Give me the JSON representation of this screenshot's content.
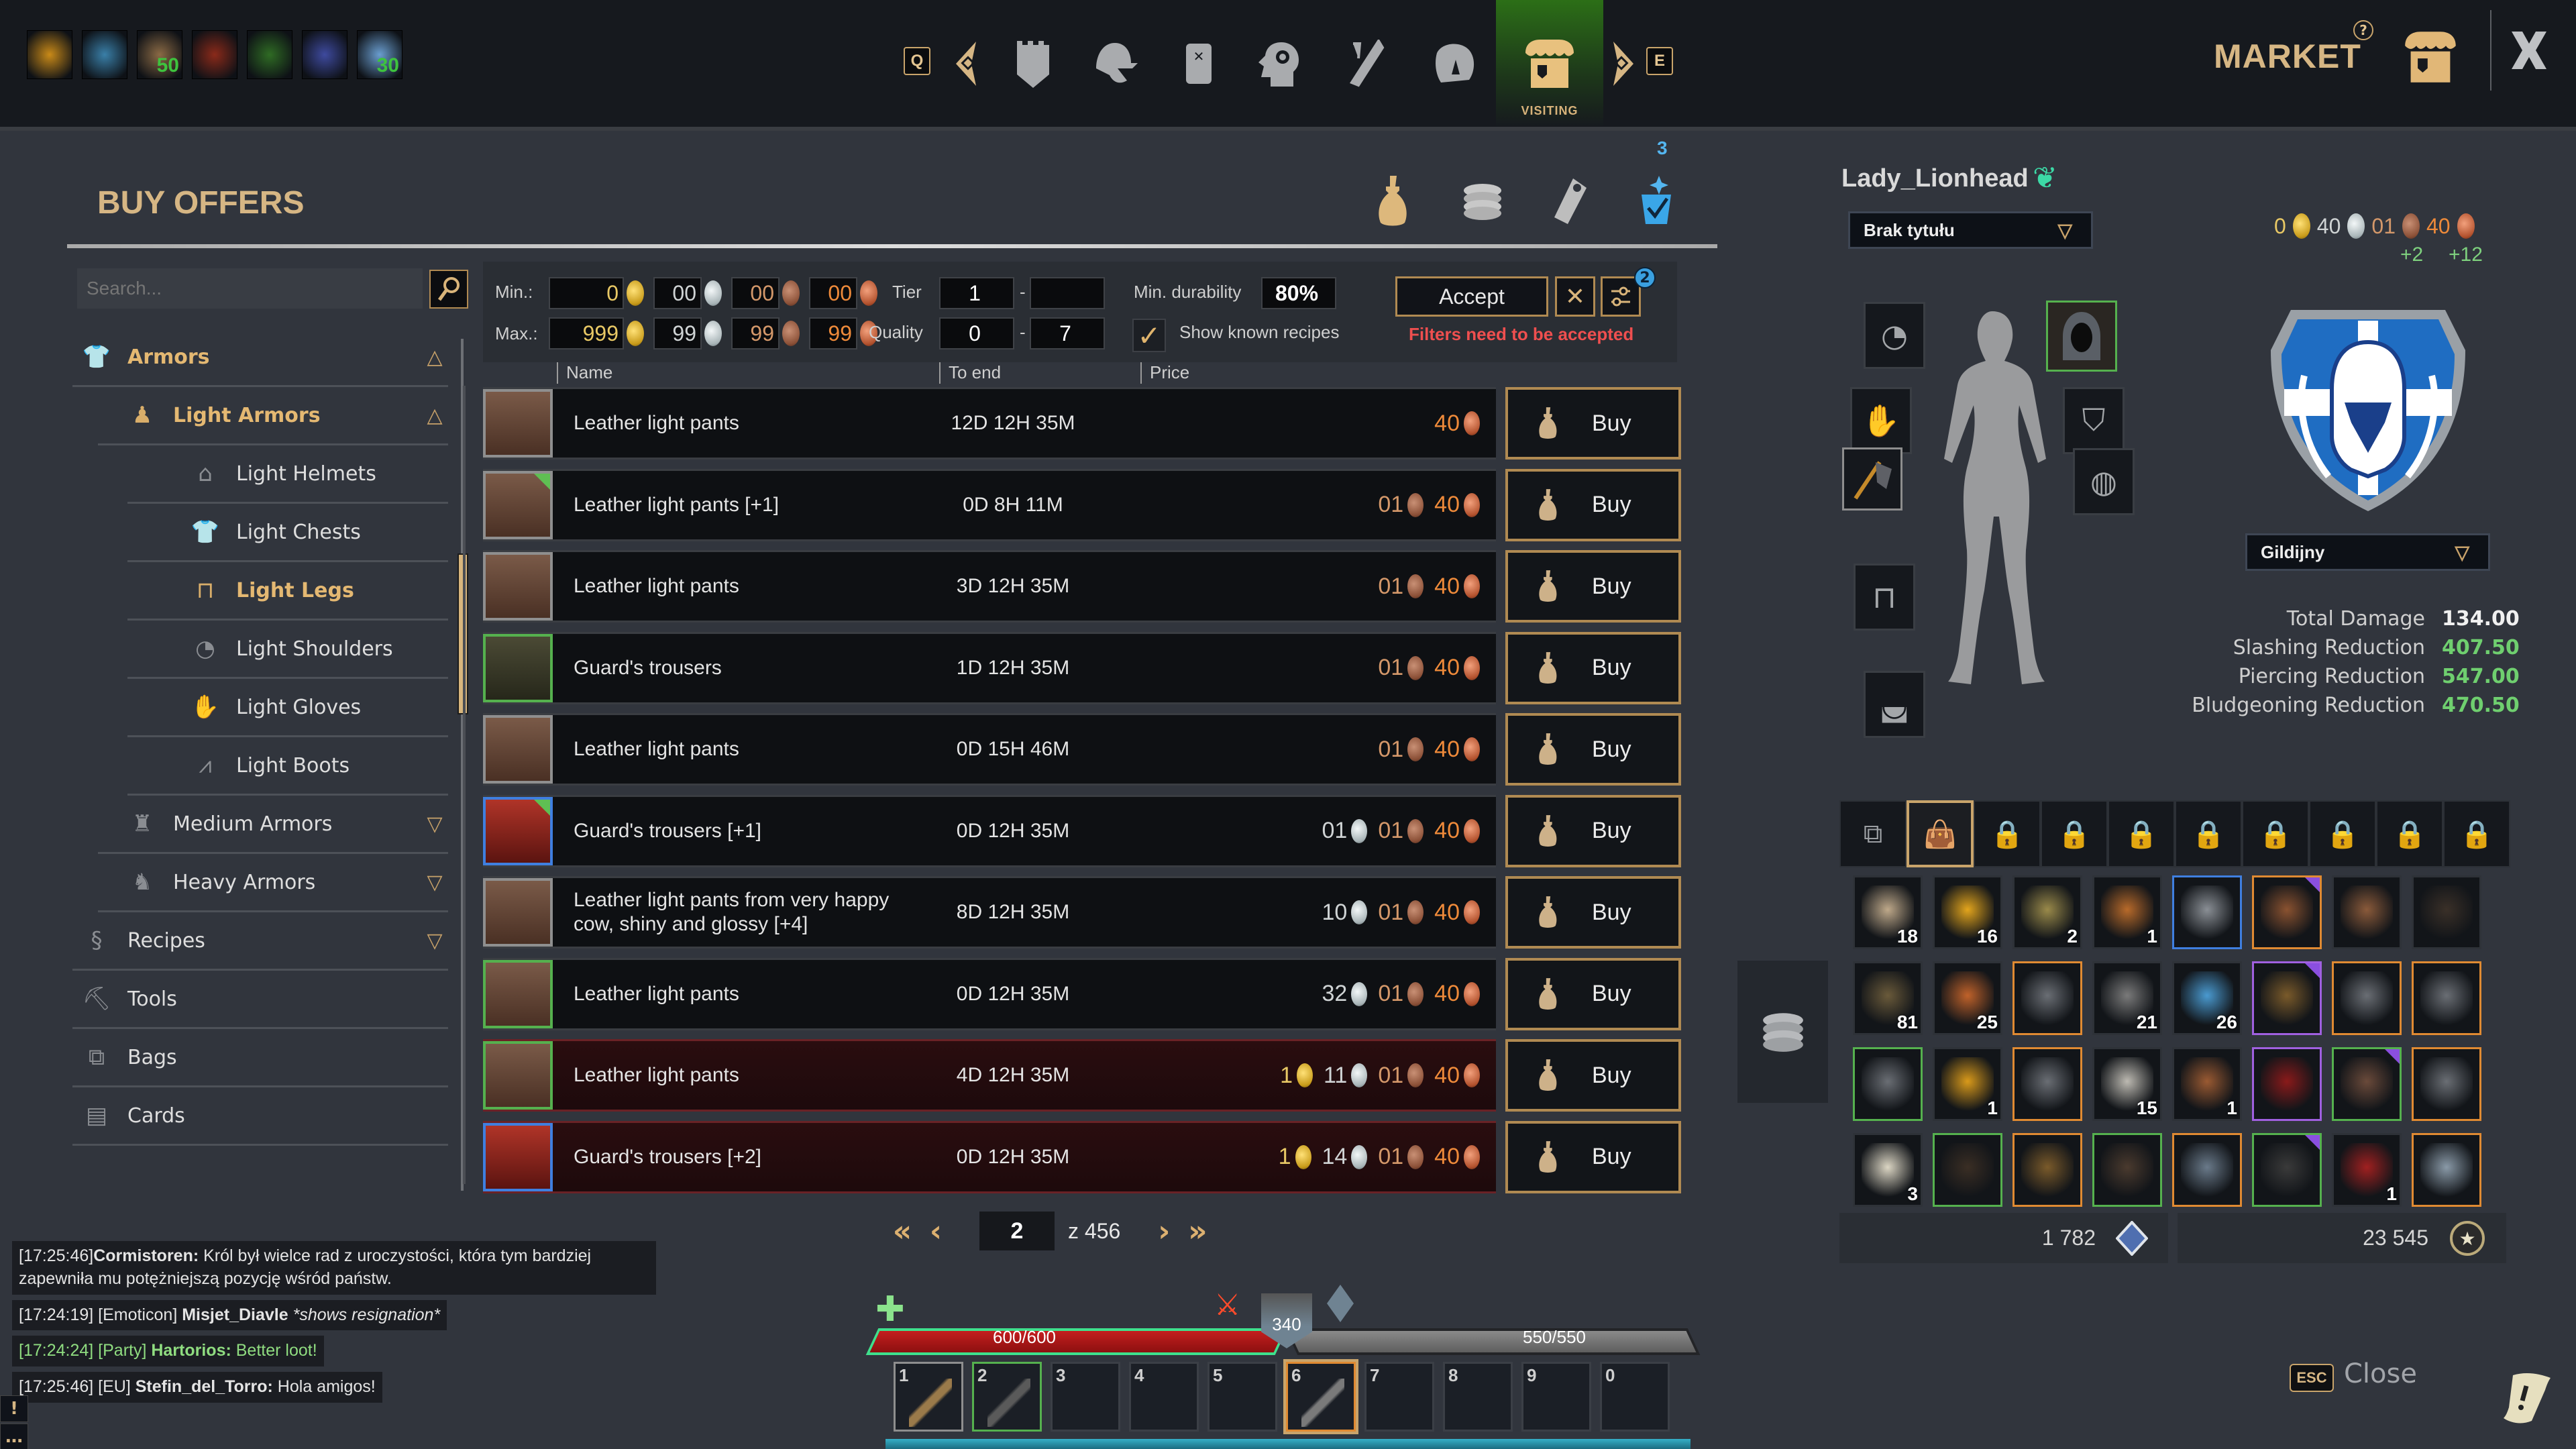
{
  "topbar": {
    "buffs": [
      {
        "name": "gold-lily-buff-icon",
        "badge": "",
        "color": "#c98a18"
      },
      {
        "name": "ice-warrior-buff-icon",
        "badge": "",
        "color": "#3a7fa8"
      },
      {
        "name": "hammer-buff-icon",
        "badge": "50",
        "color": "#8b6a45"
      },
      {
        "name": "red-gauntlet-buff-icon",
        "badge": "",
        "color": "#8a2a1a"
      },
      {
        "name": "rank-chevrons-buff-icon",
        "badge": "",
        "color": "#2f6b24"
      },
      {
        "name": "dove-buff-icon",
        "badge": "",
        "color": "#3e4a9e"
      },
      {
        "name": "map-buff-icon",
        "badge": "30",
        "color": "#6a9ed0"
      }
    ],
    "nav_keys": {
      "prev": "Q",
      "next": "E"
    },
    "nav_icons": [
      "guild-banner-icon",
      "helmet-icon",
      "scroll-quest-icon",
      "skills-head-gear-icon",
      "crafting-hammer-icon",
      "world-map-icon",
      "market-stall-icon"
    ],
    "active_nav_label": "VISITING",
    "title": "MARKET",
    "help_glyph": "?"
  },
  "buy_offers": {
    "title": "BUY OFFERS",
    "tabs": [
      "money-bag-tab-icon",
      "coin-stack-tab-icon",
      "price-tag-tab-icon",
      "recipe-scroll-tab-icon"
    ],
    "recipe_tab_badge": "3",
    "search": {
      "placeholder": "Search...",
      "value": ""
    },
    "categories": [
      {
        "label": "Armors",
        "level": 0,
        "state": "expanded",
        "highlight": true,
        "icon": "armor-icon"
      },
      {
        "label": "Light Armors",
        "level": 1,
        "state": "expanded",
        "highlight": true,
        "icon": "light-armor-icon"
      },
      {
        "label": "Light Helmets",
        "level": 2,
        "state": "",
        "highlight": false,
        "icon": "hood-icon"
      },
      {
        "label": "Light Chests",
        "level": 2,
        "state": "",
        "highlight": false,
        "icon": "shirt-icon"
      },
      {
        "label": "Light Legs",
        "level": 2,
        "state": "",
        "highlight": true,
        "icon": "pants-icon"
      },
      {
        "label": "Light Shoulders",
        "level": 2,
        "state": "",
        "highlight": false,
        "icon": "shoulder-icon"
      },
      {
        "label": "Light Gloves",
        "level": 2,
        "state": "",
        "highlight": false,
        "icon": "gloves-icon"
      },
      {
        "label": "Light Boots",
        "level": 2,
        "state": "",
        "highlight": false,
        "icon": "boots-icon"
      },
      {
        "label": "Medium Armors",
        "level": 1,
        "state": "collapsed",
        "highlight": false,
        "icon": "medium-armor-icon"
      },
      {
        "label": "Heavy Armors",
        "level": 1,
        "state": "collapsed",
        "highlight": false,
        "icon": "heavy-armor-icon"
      },
      {
        "label": "Recipes",
        "level": 0,
        "state": "collapsed",
        "highlight": false,
        "icon": "recipe-icon"
      },
      {
        "label": "Tools",
        "level": 0,
        "state": "",
        "highlight": false,
        "icon": "pickaxe-icon"
      },
      {
        "label": "Bags",
        "level": 0,
        "state": "",
        "highlight": false,
        "icon": "bags-icon"
      },
      {
        "label": "Cards",
        "level": 0,
        "state": "",
        "highlight": false,
        "icon": "cards-icon"
      }
    ],
    "filters": {
      "min_label": "Min.:",
      "max_label": "Max.:",
      "min_price": {
        "gold": "0",
        "silver": "00",
        "copper": "00",
        "bronze": "00"
      },
      "max_price": {
        "gold": "999",
        "silver": "99",
        "copper": "99",
        "bronze": "99"
      },
      "tier_label": "Tier",
      "tier_min": "1",
      "tier_max": "",
      "quality_label": "Quality",
      "quality_min": "0",
      "quality_max": "7",
      "range_sep": "-",
      "durability_label": "Min. durability",
      "durability_value": "80%",
      "known_recipes_label": "Show known recipes",
      "known_recipes_checked": true,
      "accept_label": "Accept",
      "clear_glyph": "✕",
      "advanced_badge": "2",
      "warning": "Filters need to be accepted"
    },
    "columns": {
      "name": "Name",
      "to_end": "To end",
      "price": "Price"
    },
    "buy_label": "Buy",
    "offers": [
      {
        "name": "Leather light pants",
        "to_end": "12D 12H 35M",
        "gold": "",
        "silver": "",
        "copper": "",
        "bronze": "40",
        "thumb": "leather",
        "border": "grey",
        "corner": false,
        "red": false
      },
      {
        "name": "Leather light pants [+1]",
        "to_end": "0D 8H 11M",
        "gold": "",
        "silver": "",
        "copper": "01",
        "bronze": "40",
        "thumb": "leather",
        "border": "grey",
        "corner": true,
        "red": false
      },
      {
        "name": "Leather light pants",
        "to_end": "3D 12H 35M",
        "gold": "",
        "silver": "",
        "copper": "01",
        "bronze": "40",
        "thumb": "leather",
        "border": "grey",
        "corner": false,
        "red": false
      },
      {
        "name": "Guard's trousers",
        "to_end": "1D 12H 35M",
        "gold": "",
        "silver": "",
        "copper": "01",
        "bronze": "40",
        "thumb": "dark",
        "border": "green",
        "corner": false,
        "red": false
      },
      {
        "name": "Leather light pants",
        "to_end": "0D 15H 46M",
        "gold": "",
        "silver": "",
        "copper": "01",
        "bronze": "40",
        "thumb": "leather",
        "border": "grey",
        "corner": false,
        "red": false
      },
      {
        "name": "Guard's trousers [+1]",
        "to_end": "0D 12H 35M",
        "gold": "",
        "silver": "01",
        "copper": "01",
        "bronze": "40",
        "thumb": "redpants",
        "border": "blue",
        "corner": true,
        "red": false
      },
      {
        "name": "Leather light pants from very happy cow, shiny and glossy [+4]",
        "to_end": "8D 12H 35M",
        "gold": "",
        "silver": "10",
        "copper": "01",
        "bronze": "40",
        "thumb": "leather",
        "border": "grey",
        "corner": false,
        "red": false
      },
      {
        "name": "Leather light pants",
        "to_end": "0D 12H 35M",
        "gold": "",
        "silver": "32",
        "copper": "01",
        "bronze": "40",
        "thumb": "leather",
        "border": "green",
        "corner": false,
        "red": false
      },
      {
        "name": "Leather light pants",
        "to_end": "4D 12H 35M",
        "gold": "1",
        "silver": "11",
        "copper": "01",
        "bronze": "40",
        "thumb": "leather",
        "border": "green",
        "corner": false,
        "red": true
      },
      {
        "name": "Guard's trousers [+2]",
        "to_end": "0D 12H 35M",
        "gold": "1",
        "silver": "14",
        "copper": "01",
        "bronze": "40",
        "thumb": "redpants",
        "border": "blue",
        "corner": false,
        "red": true
      }
    ],
    "pagination": {
      "current": "2",
      "of_label": "z 456",
      "first": "«",
      "prev": "‹",
      "next": "›",
      "last": "»"
    }
  },
  "chat": [
    {
      "time": "[17:25:46]",
      "channel": "",
      "user": "Cormistoren:",
      "text": " Król był wielce rad z uroczystości, która tym bardziej zapewniła mu potężniejszą pozycję wśród państw.",
      "style": "normal",
      "italic": false
    },
    {
      "time": "[17:24:19]",
      "channel": " [Emoticon]",
      "user": " Misjet_Diavle",
      "text": " *shows resignation*",
      "style": "normal",
      "italic": true
    },
    {
      "time": "[17:24:24]",
      "channel": " [Party]",
      "user": " Hartorios:",
      "text": "  Better loot!",
      "style": "party",
      "italic": false
    },
    {
      "time": "[17:25:46]",
      "channel": " [EU]",
      "user": " Stefin_del_Torro:",
      "text": "  Hola amigos!",
      "style": "normal",
      "italic": false
    }
  ],
  "hud": {
    "hp_text": "600/600",
    "hp_fraction": 1.0,
    "stamina_text": "550/550",
    "stamina_fraction": 1.0,
    "armor_value": "340",
    "hotbar": [
      {
        "key": "1",
        "item": "bow-icon",
        "border": "grey",
        "color": "#9a7a4a"
      },
      {
        "key": "2",
        "item": "pickaxe-icon",
        "border": "green",
        "color": "#5a5a5a"
      },
      {
        "key": "3",
        "item": "",
        "border": "",
        "color": ""
      },
      {
        "key": "4",
        "item": "",
        "border": "",
        "color": ""
      },
      {
        "key": "5",
        "item": "",
        "border": "",
        "color": ""
      },
      {
        "key": "6",
        "item": "axe-icon",
        "border": "sel",
        "color": "#7a7a7a"
      },
      {
        "key": "7",
        "item": "",
        "border": "",
        "color": ""
      },
      {
        "key": "8",
        "item": "",
        "border": "",
        "color": ""
      },
      {
        "key": "9",
        "item": "",
        "border": "",
        "color": ""
      },
      {
        "key": "0",
        "item": "",
        "border": "",
        "color": ""
      }
    ]
  },
  "character": {
    "name": "Lady_Lionhead",
    "title_dropdown": "Brak tytułu",
    "guild_dropdown": "Gildijny",
    "wallet": {
      "gold": "0",
      "silver": "40",
      "copper": "01",
      "bronze": "40",
      "copper_delta": "+2",
      "bronze_delta": "+12"
    },
    "stats": [
      {
        "label": "Total Damage",
        "value": "134.00",
        "color": "#f0f0f0"
      },
      {
        "label": "Slashing Reduction",
        "value": "407.50",
        "color": "#6fcf6f"
      },
      {
        "label": "Piercing Reduction",
        "value": "547.00",
        "color": "#6fcf6f"
      },
      {
        "label": "Bludgeoning Reduction",
        "value": "470.50",
        "color": "#6fcf6f"
      }
    ]
  },
  "inventory": {
    "bag_tabs": [
      "all-bags-icon",
      "leather-bag-icon",
      "lock-icon",
      "lock-icon",
      "lock-icon",
      "lock-icon",
      "lock-icon",
      "lock-icon",
      "lock-icon",
      "lock-icon"
    ],
    "items": [
      {
        "name": "wood-logs",
        "qty": "18",
        "border": "",
        "color": "#bfa98a",
        "tri": false
      },
      {
        "name": "cheese-wheel",
        "qty": "16",
        "border": "",
        "color": "#e3a51c",
        "tri": false
      },
      {
        "name": "scroll",
        "qty": "2",
        "border": "",
        "color": "#9a8a4a",
        "tri": false
      },
      {
        "name": "leather-book",
        "qty": "1",
        "border": "",
        "color": "#b86a2a",
        "tri": false
      },
      {
        "name": "longsword",
        "qty": "",
        "border": "blue",
        "color": "#8a8f95",
        "tri": false
      },
      {
        "name": "leather-armor",
        "qty": "",
        "border": "orange",
        "color": "#8a5230",
        "tri": true
      },
      {
        "name": "leather-boots",
        "qty": "",
        "border": "",
        "color": "#8a5a3a",
        "tri": false
      },
      {
        "name": "fishing-net",
        "qty": "",
        "border": "",
        "color": "#3a3028",
        "tri": false
      },
      {
        "name": "ore-chunk",
        "qty": "81",
        "border": "",
        "color": "#6a5a3a",
        "tri": false
      },
      {
        "name": "copper-ore",
        "qty": "25",
        "border": "",
        "color": "#c0622a",
        "tri": false
      },
      {
        "name": "katana",
        "qty": "",
        "border": "orange",
        "color": "#6a6e74",
        "tri": false
      },
      {
        "name": "stone-pile",
        "qty": "21",
        "border": "",
        "color": "#7a7a7a",
        "tri": false
      },
      {
        "name": "water-basin",
        "qty": "26",
        "border": "",
        "color": "#4a9ad0",
        "tri": false
      },
      {
        "name": "longbow",
        "qty": "",
        "border": "purple",
        "color": "#7a5a2a",
        "tri": true
      },
      {
        "name": "battle-axe",
        "qty": "",
        "border": "orange",
        "color": "#6a6e74",
        "tri": false
      },
      {
        "name": "halberd",
        "qty": "",
        "border": "orange",
        "color": "#6a6e74",
        "tri": false
      },
      {
        "name": "pickaxe",
        "qty": "",
        "border": "green",
        "color": "#6a6e74",
        "tri": false
      },
      {
        "name": "card-horse",
        "qty": "1",
        "border": "",
        "color": "#d99a1a",
        "tri": false
      },
      {
        "name": "thin-sword",
        "qty": "",
        "border": "orange",
        "color": "#6a6e74",
        "tri": false
      },
      {
        "name": "cloth",
        "qty": "15",
        "border": "",
        "color": "#bdbab2",
        "tri": false
      },
      {
        "name": "bucket",
        "qty": "1",
        "border": "",
        "color": "#9a5a32",
        "tri": false
      },
      {
        "name": "pitchfork",
        "qty": "",
        "border": "purple",
        "color": "#8a1a1a",
        "tri": false
      },
      {
        "name": "leather-pants",
        "qty": "",
        "border": "green",
        "color": "#6a4a3a",
        "tri": true
      },
      {
        "name": "greatsword",
        "qty": "",
        "border": "orange",
        "color": "#6a6e74",
        "tri": false
      },
      {
        "name": "thread-spool",
        "qty": "3",
        "border": "",
        "color": "#dcd6c4",
        "tri": false
      },
      {
        "name": "bear-pelt",
        "qty": "",
        "border": "green",
        "color": "#3a2e24",
        "tri": false
      },
      {
        "name": "bow",
        "qty": "",
        "border": "orange",
        "color": "#7a5a2a",
        "tri": false
      },
      {
        "name": "chain-armor",
        "qty": "",
        "border": "green",
        "color": "#4a3a2e",
        "tri": false
      },
      {
        "name": "crossbow-bolt",
        "qty": "",
        "border": "orange",
        "color": "#6a7a8a",
        "tri": false
      },
      {
        "name": "iron-hood",
        "qty": "",
        "border": "green",
        "color": "#3a3a3a",
        "tri": true
      },
      {
        "name": "crusader-helmet",
        "qty": "1",
        "border": "",
        "color": "#a02020",
        "tri": false
      },
      {
        "name": "plate-armor",
        "qty": "",
        "border": "orange",
        "color": "#8a9aa8",
        "tri": false
      }
    ],
    "gems": "1 782",
    "honor": "23 545"
  },
  "footer": {
    "esc_key": "ESC",
    "close_label": "Close"
  },
  "colors": {
    "accent_gold": "#d6b684",
    "warning_red": "#ef4f4f",
    "stat_green": "#6fcf6f",
    "party_green": "#8fdc80"
  }
}
